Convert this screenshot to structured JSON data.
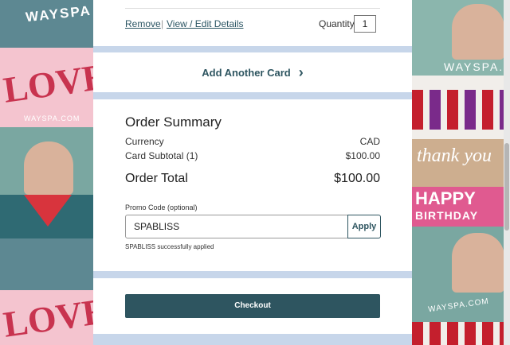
{
  "item": {
    "remove_label": "Remove",
    "view_edit_label": "View / Edit Details",
    "quantity_label": "Quantity",
    "quantity_value": "1"
  },
  "add_card": {
    "label": "Add Another Card",
    "chevron": "›"
  },
  "summary": {
    "title": "Order Summary",
    "currency_label": "Currency",
    "currency_value": "CAD",
    "subtotal_label": "Card Subtotal (1)",
    "subtotal_value": "$100.00",
    "total_label": "Order Total",
    "total_value": "$100.00"
  },
  "promo": {
    "label": "Promo Code (optional)",
    "value": "SPABLISS",
    "apply_label": "Apply",
    "status": "SPABLISS successfully applied"
  },
  "checkout": {
    "label": "Checkout"
  },
  "background": {
    "left_top_text": "WAYSPA",
    "love_text": "LOVE",
    "wayspa_url": "WAYSPA.COM",
    "right_top_text": "WAYSPA.C",
    "thank_you_text": "thank you",
    "happy_text": "HAPPY",
    "birthday_text": "BIRTHDAY",
    "right_bottom_text": "WAYSPA.COM"
  },
  "colors": {
    "accent": "#2e5560",
    "page_bg": "#c7d6ea",
    "text": "#333333"
  }
}
